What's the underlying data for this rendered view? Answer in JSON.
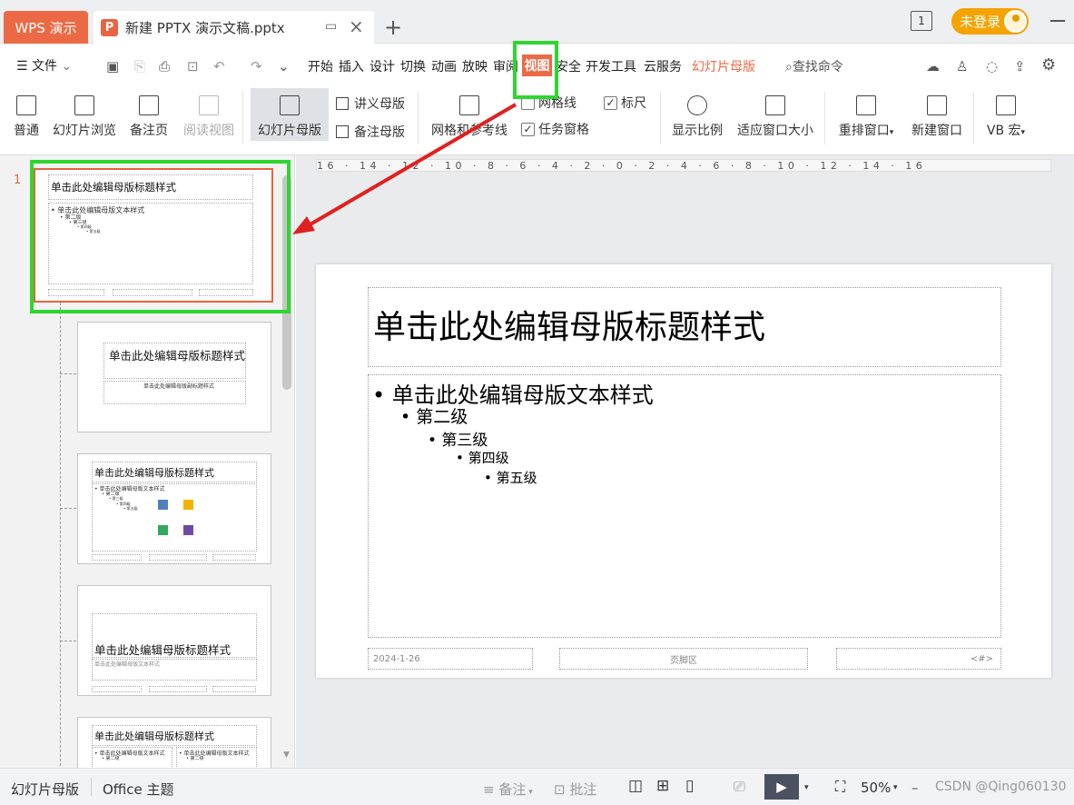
{
  "titlebar": {
    "app_tab": "WPS 演示",
    "doc_icon": "P",
    "doc_name": "新建 PPTX 演示文稿.pptx",
    "new_tab": "+",
    "slide_indicator": "1",
    "login": "未登录"
  },
  "menu": {
    "file": "文件",
    "items": [
      "开始",
      "插入",
      "设计",
      "切换",
      "动画",
      "放映",
      "审阅",
      "视图",
      "安全",
      "开发工具",
      "云服务",
      "幻灯片母版"
    ],
    "search": "查找命令"
  },
  "ribbon": {
    "normal": "普通",
    "slide_sorter": "幻灯片浏览",
    "notes_page": "备注页",
    "reading_view": "阅读视图",
    "slide_master": "幻灯片母版",
    "handout_master": "讲义母版",
    "notes_master": "备注母版",
    "grid_guides": "网格和参考线",
    "gridlines": "网格线",
    "ruler": "标尺",
    "task_pane": "任务窗格",
    "zoom": "显示比例",
    "fit_window": "适应窗口大小",
    "arrange": "重排窗口",
    "new_window": "新建窗口",
    "vb_macro": "VB 宏",
    "gridlines_checked": false,
    "ruler_checked": true,
    "task_pane_checked": true
  },
  "panel": {
    "slide_number": "1",
    "thumb1_title": "单击此处编辑母版标题样式",
    "thumb1_body": [
      "• 单击此处编辑母版文本样式",
      "• 第二级",
      "• 第三级",
      "• 第四级",
      "• 第五级"
    ],
    "thumb2_title": "单击此处编辑母版标题样式",
    "thumb2_sub": "单击此处编辑母版副标题样式",
    "thumb3_title": "单击此处编辑母版标题样式",
    "thumb3_body": [
      "• 单击此处编辑母版文本样式",
      "• 第二级",
      "• 第三级",
      "• 第四级",
      "• 第五级"
    ],
    "thumb4_title": "单击此处编辑母版标题样式",
    "thumb4_sub": "单击此处编辑母版文本样式",
    "thumb5_title": "单击此处编辑母版标题样式",
    "thumb5_left": "• 单击此处编辑母版文本样式",
    "thumb5_right": "• 单击此处编辑母版文本样式",
    "thumb5_l2": "• 第二级"
  },
  "ruler_text": "16 · 14 · 12 · 10 · 8 · 6 · 4 · 2 · 0 · 2 · 4 · 6 · 8 · 10 · 12 · 14 · 16",
  "slide": {
    "title": "单击此处编辑母版标题样式",
    "level1": "• 单击此处编辑母版文本样式",
    "level2": "• 第二级",
    "level3": "• 第三级",
    "level4": "• 第四级",
    "level5": "• 第五级",
    "date": "2024-1-26",
    "footer": "页脚区",
    "number": "<#>"
  },
  "status": {
    "view": "幻灯片母版",
    "theme": "Office 主题",
    "notes": "备注",
    "comments": "批注",
    "zoom": "50%",
    "watermark": "CSDN @Qing060130"
  },
  "colors": {
    "accent": "#eb6a45",
    "highlight": "#2fd62f",
    "arrow": "#e02020"
  }
}
